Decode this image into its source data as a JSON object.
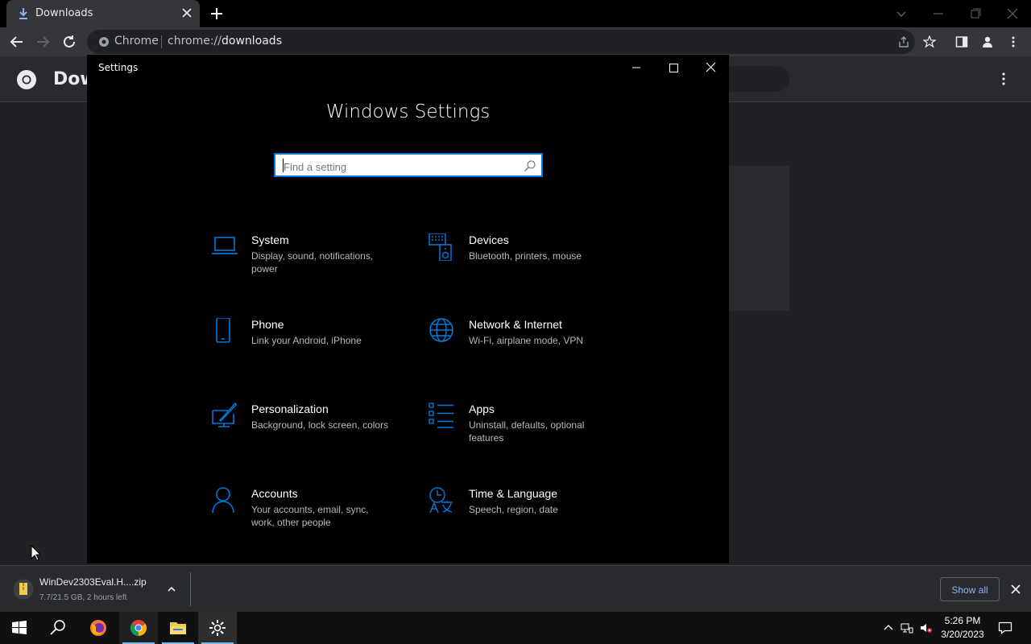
{
  "browser": {
    "tab": {
      "title": "Downloads"
    },
    "omnibox": {
      "site_chip": "Chrome",
      "url_scheme": "chrome://",
      "url_path": "downloads"
    }
  },
  "downloads_page": {
    "header_title": "Dow"
  },
  "settings_window": {
    "window_title": "Settings",
    "heading": "Windows Settings",
    "search_placeholder": "Find a setting",
    "accent_color": "#0078d7",
    "categories": [
      {
        "title": "System",
        "desc": "Display, sound, notifications, power",
        "icon": "laptop-icon"
      },
      {
        "title": "Devices",
        "desc": "Bluetooth, printers, mouse",
        "icon": "keyboard-speaker-icon"
      },
      {
        "title": "Phone",
        "desc": "Link your Android, iPhone",
        "icon": "phone-icon"
      },
      {
        "title": "Network & Internet",
        "desc": "Wi-Fi, airplane mode, VPN",
        "icon": "globe-icon"
      },
      {
        "title": "Personalization",
        "desc": "Background, lock screen, colors",
        "icon": "paint-brush-icon"
      },
      {
        "title": "Apps",
        "desc": "Uninstall, defaults, optional features",
        "icon": "apps-list-icon"
      },
      {
        "title": "Accounts",
        "desc": "Your accounts, email, sync, work, other people",
        "icon": "person-icon"
      },
      {
        "title": "Time & Language",
        "desc": "Speech, region, date",
        "icon": "time-language-icon"
      }
    ]
  },
  "download_shelf": {
    "file_name": "WinDev2303Eval.H....zip",
    "status": "7.7/21.5 GB, 2 hours left",
    "show_all": "Show all"
  },
  "taskbar": {
    "time": "5:26 PM",
    "date": "3/20/2023"
  }
}
